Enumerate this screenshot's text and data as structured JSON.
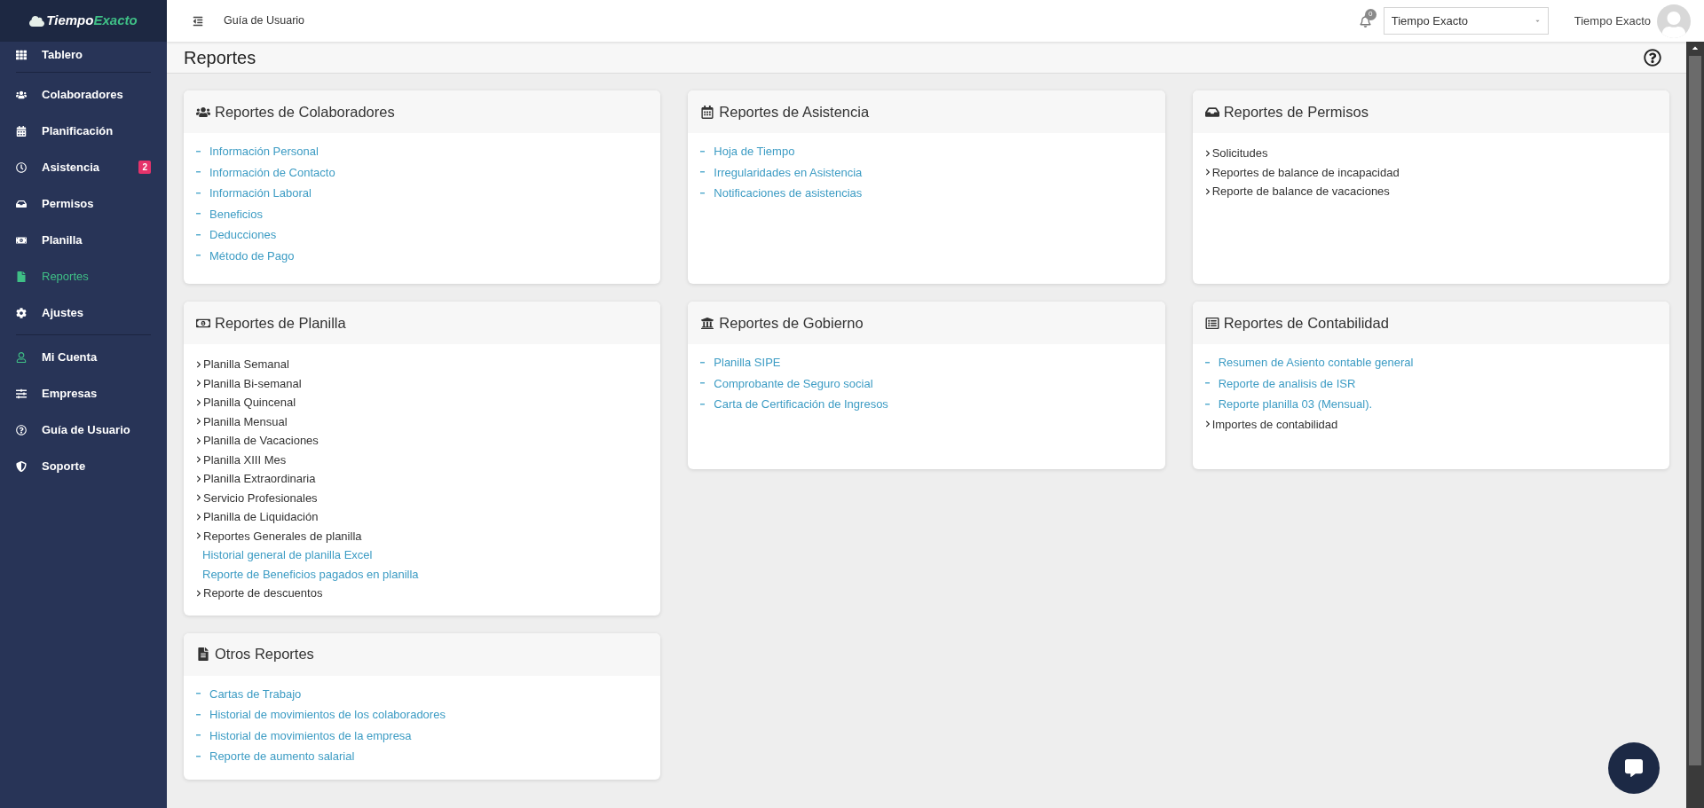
{
  "logo": {
    "first": "Tiempo",
    "second": "Exacto"
  },
  "sidebar": {
    "groups": [
      [
        {
          "label": "Tablero",
          "selected": false
        }
      ],
      [
        {
          "label": "Colaboradores",
          "selected": false
        },
        {
          "label": "Planificación",
          "selected": false
        },
        {
          "label": "Asistencia",
          "selected": false,
          "badge": "2"
        },
        {
          "label": "Permisos",
          "selected": false
        },
        {
          "label": "Planilla",
          "selected": false
        },
        {
          "label": "Reportes",
          "selected": true
        },
        {
          "label": "Ajustes",
          "selected": false
        }
      ],
      [
        {
          "label": "Mi Cuenta",
          "selected": false
        },
        {
          "label": "Empresas",
          "selected": false
        },
        {
          "label": "Guía de Usuario",
          "selected": false
        },
        {
          "label": "Soporte",
          "selected": false
        }
      ]
    ]
  },
  "topbar": {
    "title": "Guía de Usuario",
    "notifications": "0",
    "company_select": {
      "value": "Tiempo Exacto"
    },
    "user_name": "Tiempo Exacto"
  },
  "page": {
    "title": "Reportes"
  },
  "columns": [
    [
      {
        "title": "Reportes de Colaboradores",
        "items": [
          {
            "kind": "link",
            "label": "Información Personal"
          },
          {
            "kind": "link",
            "label": "Información de Contacto"
          },
          {
            "kind": "link",
            "label": "Información Laboral"
          },
          {
            "kind": "link",
            "label": "Beneficios"
          },
          {
            "kind": "link",
            "label": "Deducciones"
          },
          {
            "kind": "link",
            "label": "Método de Pago"
          }
        ]
      },
      {
        "title": "Reportes de Planilla",
        "items": [
          {
            "kind": "folder",
            "label": "Planilla Semanal"
          },
          {
            "kind": "folder",
            "label": "Planilla Bi-semanal"
          },
          {
            "kind": "folder",
            "label": "Planilla Quincenal"
          },
          {
            "kind": "folder",
            "label": "Planilla Mensual"
          },
          {
            "kind": "folder",
            "label": "Planilla de Vacaciones"
          },
          {
            "kind": "folder",
            "label": "Planilla XIII Mes"
          },
          {
            "kind": "folder",
            "label": "Planilla Extraordinaria"
          },
          {
            "kind": "folder",
            "label": "Servicio Profesionales"
          },
          {
            "kind": "folder",
            "label": "Planilla de Liquidación"
          },
          {
            "kind": "folder",
            "label": "Reportes Generales de planilla",
            "children": [
              {
                "kind": "sublink",
                "label": "Historial general de planilla Excel"
              },
              {
                "kind": "sublink",
                "label": "Reporte de Beneficios pagados en planilla"
              }
            ]
          },
          {
            "kind": "folder",
            "label": "Reporte de descuentos"
          }
        ]
      },
      {
        "title": "Otros Reportes",
        "items": [
          {
            "kind": "link",
            "label": "Cartas de Trabajo"
          },
          {
            "kind": "link",
            "label": "Historial de movimientos de los colaboradores"
          },
          {
            "kind": "link",
            "label": "Historial de movimientos de la empresa"
          },
          {
            "kind": "link",
            "label": "Reporte de aumento salarial"
          }
        ]
      }
    ],
    [
      {
        "title": "Reportes de Asistencia",
        "items": [
          {
            "kind": "link",
            "label": "Hoja de Tiempo"
          },
          {
            "kind": "link",
            "label": "Irregularidades en Asistencia"
          },
          {
            "kind": "link",
            "label": "Notificaciones de asistencias"
          }
        ]
      },
      {
        "title": "Reportes de Gobierno",
        "items": [
          {
            "kind": "link",
            "label": "Planilla SIPE"
          },
          {
            "kind": "link",
            "label": "Comprobante de Seguro social"
          },
          {
            "kind": "link",
            "label": "Carta de Certificación de Ingresos"
          }
        ]
      }
    ],
    [
      {
        "title": "Reportes de Permisos",
        "items": [
          {
            "kind": "folder",
            "label": "Solicitudes"
          },
          {
            "kind": "folder",
            "label": "Reportes de balance de incapacidad"
          },
          {
            "kind": "folder",
            "label": "Reporte de balance de vacaciones"
          }
        ]
      },
      {
        "title": "Reportes de Contabilidad",
        "items": [
          {
            "kind": "link",
            "label": "Resumen de Asiento contable general"
          },
          {
            "kind": "link",
            "label": "Reporte de analisis de ISR"
          },
          {
            "kind": "link",
            "label": "Reporte planilla 03 (Mensual)."
          },
          {
            "kind": "folder",
            "label": "Importes de contabilidad"
          }
        ]
      }
    ]
  ]
}
